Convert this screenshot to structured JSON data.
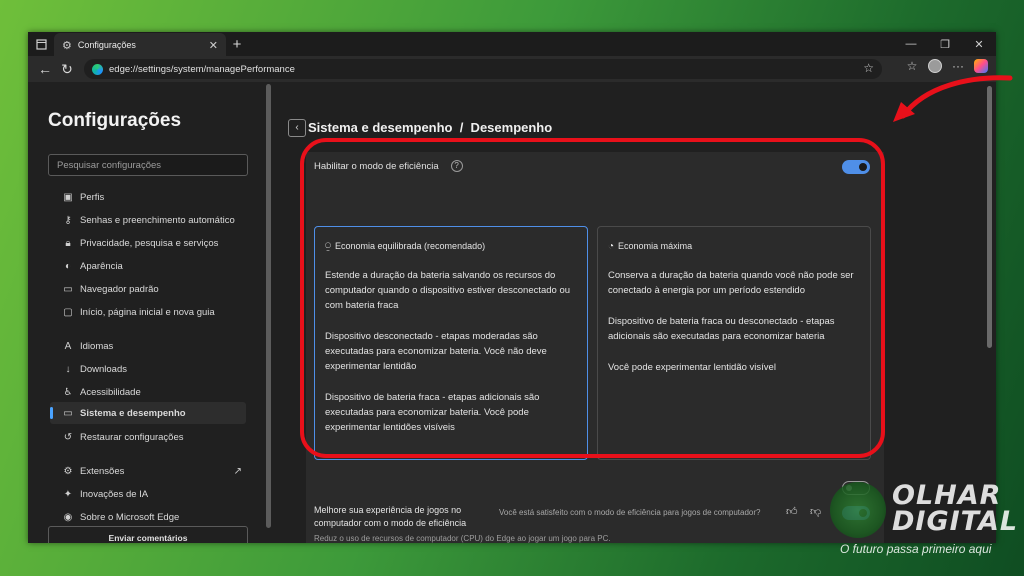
{
  "browser": {
    "tab_title": "Configurações",
    "url": "edge://settings/system/managePerformance"
  },
  "sidebar": {
    "title": "Configurações",
    "search_placeholder": "Pesquisar configurações",
    "items": [
      {
        "label": "Perfis",
        "icon": "profile-icon"
      },
      {
        "label": "Senhas e preenchimento automático",
        "icon": "key-icon"
      },
      {
        "label": "Privacidade, pesquisa e serviços",
        "icon": "lock-icon"
      },
      {
        "label": "Aparência",
        "icon": "palette-icon"
      },
      {
        "label": "Navegador padrão",
        "icon": "browser-icon"
      },
      {
        "label": "Início, página inicial e nova guia",
        "icon": "home-icon"
      },
      {
        "label": "Idiomas",
        "icon": "language-icon"
      },
      {
        "label": "Downloads",
        "icon": "download-icon"
      },
      {
        "label": "Acessibilidade",
        "icon": "accessibility-icon"
      },
      {
        "label": "Sistema e desempenho",
        "icon": "system-icon"
      },
      {
        "label": "Restaurar configurações",
        "icon": "restore-icon"
      },
      {
        "label": "Extensões",
        "icon": "extension-icon"
      },
      {
        "label": "Inovações de IA",
        "icon": "ai-icon"
      },
      {
        "label": "Sobre o Microsoft Edge",
        "icon": "edge-icon"
      }
    ],
    "feedback_label": "Enviar comentários"
  },
  "main": {
    "breadcrumb": "Sistema e desempenho  /  Desempenho",
    "efficiency_label": "Habilitar o modo de eficiência",
    "efficiency_help": "?",
    "cards": [
      {
        "title": "Economia equilibrada (recomendado)",
        "p1": "Estende a duração da bateria salvando os recursos do computador quando o dispositivo estiver desconectado ou com bateria fraca",
        "p2": "Dispositivo desconectado - etapas moderadas são executadas para economizar bateria. Você não deve experimentar lentidão",
        "p3": "Dispositivo de bateria fraca - etapas adicionais são executadas para economizar bateria. Você pode experimentar lentidões visíveis"
      },
      {
        "title": "Economia máxima",
        "p1": "Conserva a duração da bateria quando você não pode ser conectado à energia por um período estendido",
        "p2": "Dispositivo de bateria fraca ou desconectado - etapas adicionais são executadas para economizar bateria",
        "p3": "Você pode experimentar lentidão visível"
      }
    ],
    "games": {
      "title": "Melhore sua experiência de jogos no computador com o modo de eficiência",
      "subtitle": "Reduz o uso de recursos de computador (CPU) do Edge ao jogar um jogo para PC.",
      "question": "Você está satisfeito com o modo de eficiência para jogos de computador?"
    }
  },
  "watermark": {
    "line1": "OLHAR",
    "line2": "DIGITAL",
    "tagline": "O futuro passa primeiro aqui"
  },
  "colors": {
    "highlight": "#e8101a",
    "accent": "#4f8fe8"
  }
}
